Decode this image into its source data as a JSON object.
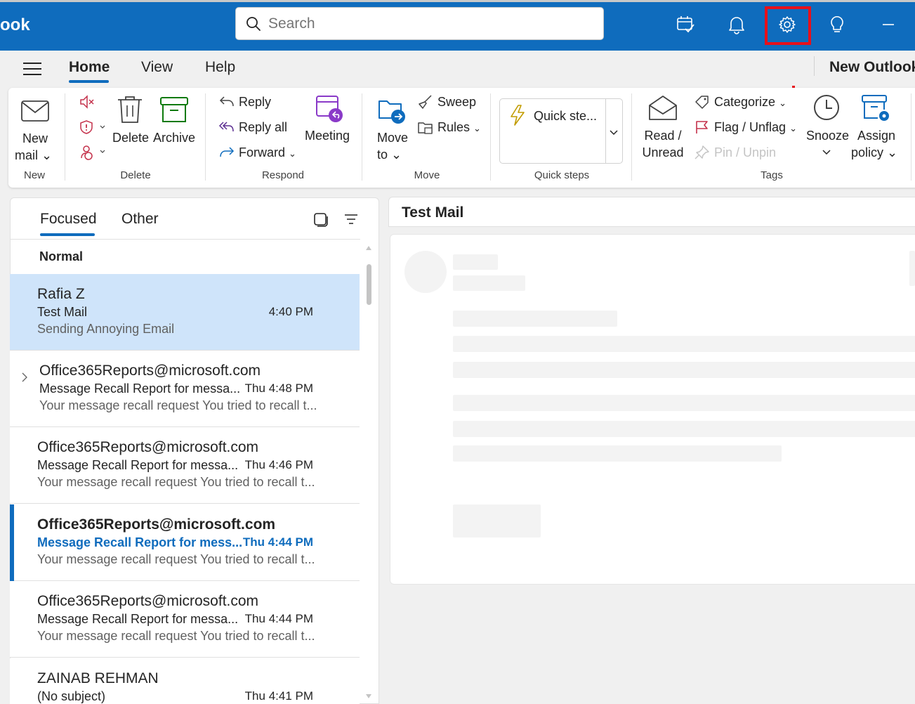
{
  "app": {
    "name": "ook"
  },
  "search": {
    "placeholder": "Search"
  },
  "menu": {
    "tabs": [
      "Home",
      "View",
      "Help"
    ],
    "new_outlook": "New Outlook"
  },
  "ribbon": {
    "new_mail": [
      "New",
      "mail"
    ],
    "delete": "Delete",
    "archive": "Archive",
    "reply": "Reply",
    "reply_all": "Reply all",
    "forward": "Forward",
    "meeting": "Meeting",
    "sweep": "Sweep",
    "rules": "Rules",
    "move_to": [
      "Move",
      "to"
    ],
    "quick_steps": "Quick ste...",
    "read_unread": [
      "Read /",
      "Unread"
    ],
    "categorize": "Categorize",
    "flag_unflag": "Flag / Unflag",
    "pin_unpin": "Pin / Unpin",
    "snooze": "Snooze",
    "assign_policy": [
      "Assign",
      "policy"
    ],
    "groups": [
      "New",
      "Delete",
      "Respond",
      "Move",
      "Quick steps",
      "Tags"
    ]
  },
  "mail_list": {
    "tabs": [
      "Focused",
      "Other"
    ],
    "group_header": "Normal",
    "items": [
      {
        "sender": "Rafia Z",
        "subject": "Test Mail",
        "time": "4:40 PM",
        "preview": "Sending Annoying Email"
      },
      {
        "sender": "Office365Reports@microsoft.com",
        "subject": "Message Recall Report for messa...",
        "time": "Thu 4:48 PM",
        "preview": "Your message recall request You tried to recall t..."
      },
      {
        "sender": "Office365Reports@microsoft.com",
        "subject": "Message Recall Report for messa...",
        "time": "Thu 4:46 PM",
        "preview": "Your message recall request You tried to recall t..."
      },
      {
        "sender": "Office365Reports@microsoft.com",
        "subject": "Message Recall Report for mess...",
        "time": "Thu 4:44 PM",
        "preview": "Your message recall request You tried to recall t..."
      },
      {
        "sender": "Office365Reports@microsoft.com",
        "subject": "Message Recall Report for messa...",
        "time": "Thu 4:44 PM",
        "preview": "Your message recall request You tried to recall t..."
      },
      {
        "sender": "ZAINAB REHMAN",
        "subject": "(No subject)",
        "time": "Thu 4:41 PM",
        "preview": ""
      }
    ]
  },
  "reading_pane": {
    "title": "Test Mail"
  },
  "colors": {
    "accent": "#0f6cbd",
    "selected": "#cfe4fa",
    "highlight": "#e8101a"
  }
}
